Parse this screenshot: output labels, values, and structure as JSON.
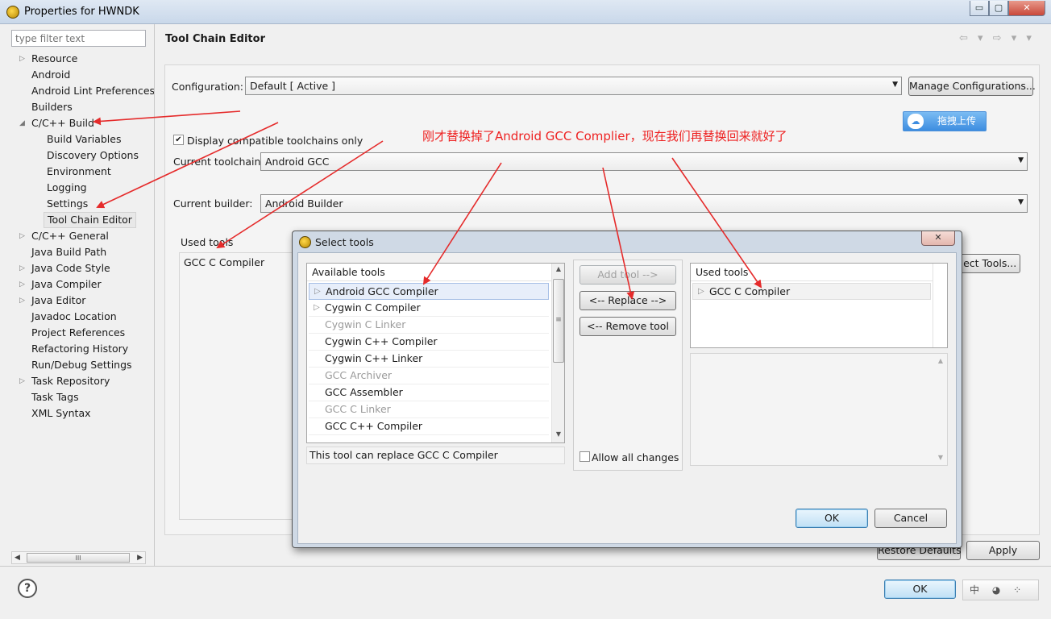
{
  "window": {
    "title": "Properties for HWNDK",
    "minimize": "▭",
    "maximize": "▢",
    "close": "✕"
  },
  "sidebar": {
    "filter_placeholder": "type filter text",
    "items": [
      {
        "label": "Resource",
        "arrow": "▷"
      },
      {
        "label": "Android",
        "arrow": ""
      },
      {
        "label": "Android Lint Preferences",
        "arrow": ""
      },
      {
        "label": "Builders",
        "arrow": ""
      },
      {
        "label": "C/C++ Build",
        "arrow": "◢"
      },
      {
        "label": "Build Variables",
        "arrow": ""
      },
      {
        "label": "Discovery Options",
        "arrow": ""
      },
      {
        "label": "Environment",
        "arrow": ""
      },
      {
        "label": "Logging",
        "arrow": ""
      },
      {
        "label": "Settings",
        "arrow": ""
      },
      {
        "label": "Tool Chain Editor",
        "arrow": ""
      },
      {
        "label": "C/C++ General",
        "arrow": "▷"
      },
      {
        "label": "Java Build Path",
        "arrow": ""
      },
      {
        "label": "Java Code Style",
        "arrow": "▷"
      },
      {
        "label": "Java Compiler",
        "arrow": "▷"
      },
      {
        "label": "Java Editor",
        "arrow": "▷"
      },
      {
        "label": "Javadoc Location",
        "arrow": ""
      },
      {
        "label": "Project References",
        "arrow": ""
      },
      {
        "label": "Refactoring History",
        "arrow": ""
      },
      {
        "label": "Run/Debug Settings",
        "arrow": ""
      },
      {
        "label": "Task Repository",
        "arrow": "▷"
      },
      {
        "label": "Task Tags",
        "arrow": ""
      },
      {
        "label": "XML Syntax",
        "arrow": ""
      }
    ],
    "hscroll_thumb": "III"
  },
  "main": {
    "title": "Tool Chain Editor",
    "nav": "⇦ ▾ ⇨ ▾ ▾",
    "configuration_label": "Configuration:",
    "configuration_value": "Default  [ Active ]",
    "manage_button": "Manage Configurations...",
    "upload_button": "拖拽上传",
    "upload_icon": "cloud-icon",
    "display_compatible_label": "Display compatible toolchains only",
    "display_compatible_checked": true,
    "current_toolchain_label": "Current toolchain:",
    "current_toolchain_value": "Android GCC",
    "current_builder_label": "Current builder:",
    "current_builder_value": "Android Builder",
    "used_tools_label": "Used tools",
    "used_tools_item": "GCC C Compiler",
    "select_tools_button": "Select Tools...",
    "annotation": "刚才替换掉了Android GCC Complier，现在我们再替换回来就好了",
    "annotation_color": "#ee2222",
    "restore_defaults_button": "Restore Defaults",
    "apply_button": "Apply"
  },
  "dialog": {
    "title": "Select tools",
    "close": "✕",
    "available_header": "Available tools",
    "available_tools": [
      {
        "label": "Android GCC Compiler",
        "enabled": true,
        "selected": true,
        "tri": true
      },
      {
        "label": "Cygwin C Compiler",
        "enabled": true,
        "selected": false,
        "tri": true
      },
      {
        "label": "Cygwin C Linker",
        "enabled": false,
        "selected": false,
        "tri": false
      },
      {
        "label": "Cygwin C++ Compiler",
        "enabled": true,
        "selected": false,
        "tri": false
      },
      {
        "label": "Cygwin C++ Linker",
        "enabled": true,
        "selected": false,
        "tri": false
      },
      {
        "label": "GCC Archiver",
        "enabled": false,
        "selected": false,
        "tri": false
      },
      {
        "label": "GCC Assembler",
        "enabled": true,
        "selected": false,
        "tri": false
      },
      {
        "label": "GCC C Linker",
        "enabled": false,
        "selected": false,
        "tri": false
      },
      {
        "label": "GCC C++ Compiler",
        "enabled": true,
        "selected": false,
        "tri": false
      }
    ],
    "add_tool_button": "Add tool -->",
    "replace_button": "<-- Replace -->",
    "remove_tool_button": "<-- Remove tool",
    "allow_all_changes_label": "Allow all changes",
    "allow_all_checked": false,
    "used_header": "Used tools",
    "used_tools": [
      "GCC C Compiler"
    ],
    "description": "This tool can replace GCC C Compiler",
    "ok_button": "OK",
    "cancel_button": "Cancel"
  },
  "footer": {
    "help": "?",
    "ok_button": "OK",
    "status_glyphs": "中 ◕ ⁘"
  }
}
